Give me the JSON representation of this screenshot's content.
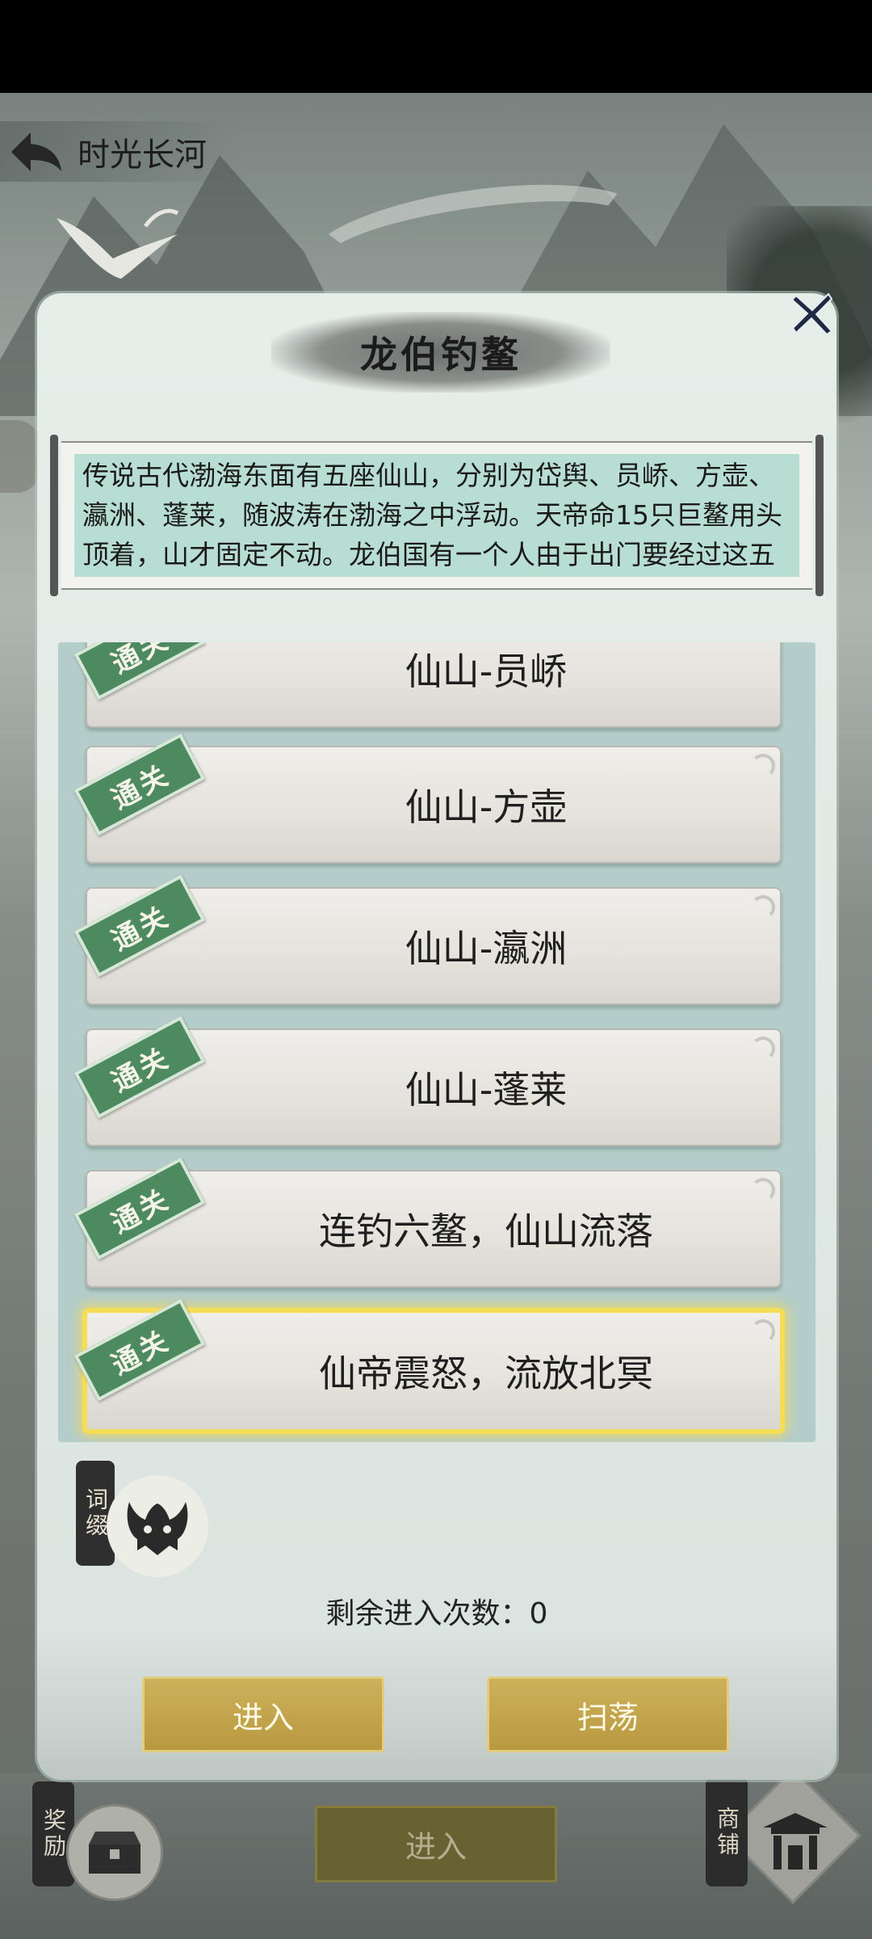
{
  "header": {
    "title": "时光长河"
  },
  "dialog": {
    "title": "龙伯钓鳌",
    "story": "传说古代渤海东面有五座仙山，分别为岱舆、员峤、方壶、瀛洲、蓬莱，随波涛在渤海之中浮动。天帝命15只巨鳌用头顶着，山才固定不动。龙伯国有一个人由于出门要经过这五座山，觉得十分不方便",
    "stages": [
      {
        "label": "仙山-员峤",
        "status": "通关"
      },
      {
        "label": "仙山-方壶",
        "status": "通关"
      },
      {
        "label": "仙山-瀛洲",
        "status": "通关"
      },
      {
        "label": "仙山-蓬莱",
        "status": "通关"
      },
      {
        "label": "连钓六鳌，仙山流落",
        "status": "通关"
      },
      {
        "label": "仙帝震怒，流放北冥",
        "status": "通关",
        "selected": true
      }
    ],
    "affix_label": "词缀",
    "remaining_label": "剩余进入次数：0",
    "enter_label": "进入",
    "sweep_label": "扫荡"
  },
  "bottom": {
    "reward_label": "奖励",
    "enter_label": "进入",
    "shop_label": "商铺"
  },
  "icons": [
    "back-arrow-icon",
    "crane-icon",
    "close-icon",
    "affix-mask-icon",
    "reward-chest-icon",
    "shop-gate-icon"
  ],
  "colors": {
    "gold_button": "#c4a84f",
    "stamp_green": "#4d8a5f",
    "panel_teal": "#b4cdca",
    "highlight": "#f5dd58"
  }
}
